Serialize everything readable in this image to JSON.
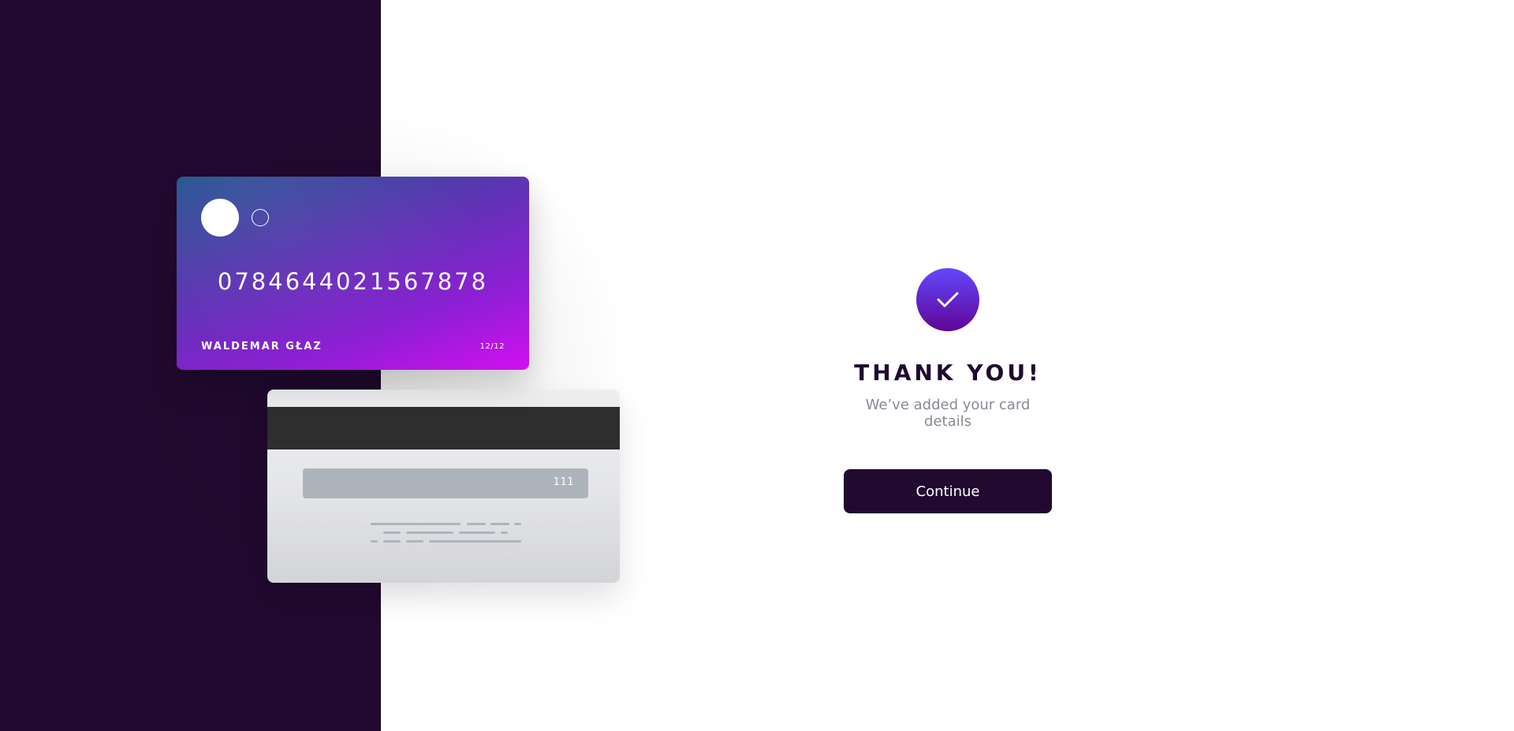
{
  "card_front": {
    "number": "0784644021567878",
    "holder_name": "WALDEMAR GŁAZ",
    "expiry": "12/12"
  },
  "card_back": {
    "cvc": "111"
  },
  "confirmation": {
    "icon": "check-icon",
    "title": "THANK YOU!",
    "subtitle": "We’ve added your card details",
    "button_label": "Continue"
  },
  "colors": {
    "left_panel": "#21092f",
    "button": "#21092f",
    "check_gradient_start": "#6348fe",
    "check_gradient_end": "#610595",
    "subtitle": "#8f8694"
  }
}
